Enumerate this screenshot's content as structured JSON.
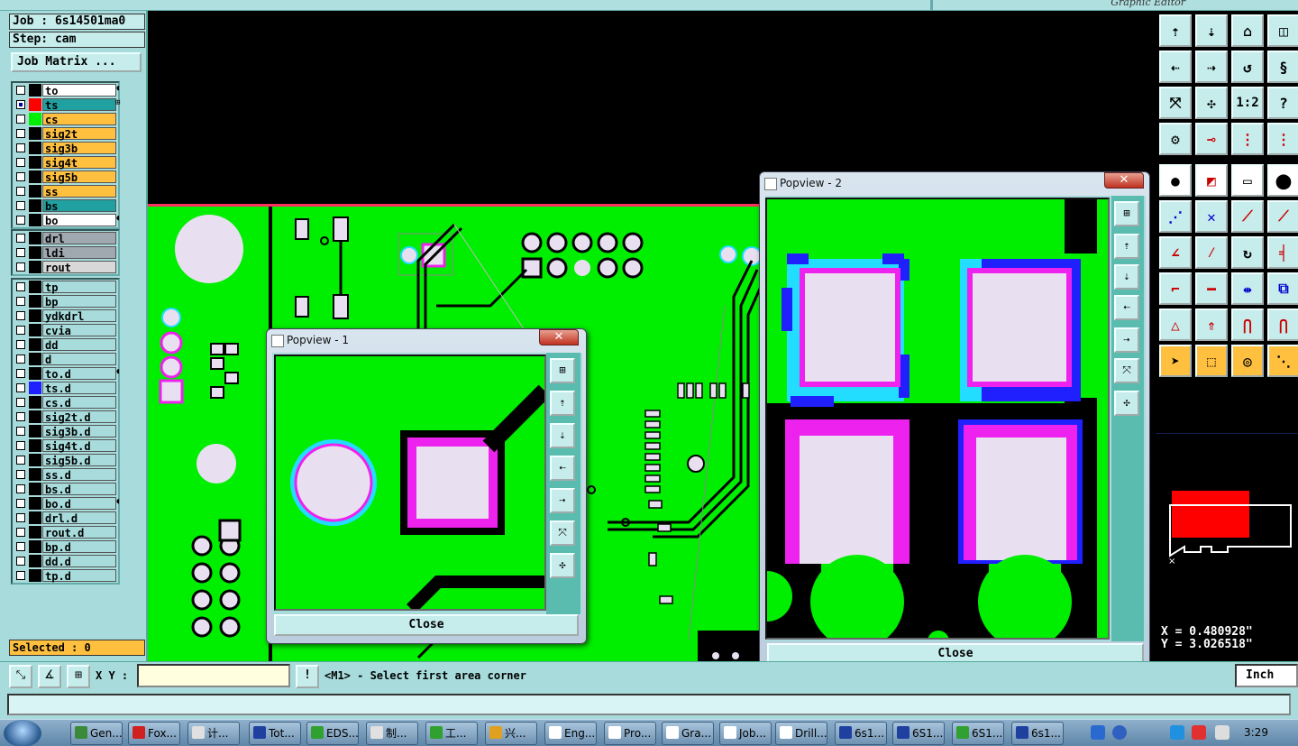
{
  "window": {
    "title_fragment": "Graphic Editor"
  },
  "left": {
    "job_label": "Job : 6s14501ma0",
    "step_label": "Step: cam",
    "job_matrix": "Job Matrix ...",
    "selected": "Selected : 0",
    "group1": [
      {
        "name": "to",
        "sel": "white",
        "mark": "◖",
        "color": "#000000",
        "checked": false
      },
      {
        "name": "ts",
        "sel": "teal",
        "mark": "⊞",
        "color": "#ff0000",
        "checked": true
      },
      {
        "name": "cs",
        "sel": "orange",
        "mark": "",
        "color": "#00ee00",
        "checked": false
      },
      {
        "name": "sig2t",
        "sel": "orange",
        "mark": "",
        "color": "#000000",
        "checked": false
      },
      {
        "name": "sig3b",
        "sel": "orange",
        "mark": "",
        "color": "#000000",
        "checked": false
      },
      {
        "name": "sig4t",
        "sel": "orange",
        "mark": "",
        "color": "#000000",
        "checked": false
      },
      {
        "name": "sig5b",
        "sel": "orange",
        "mark": "",
        "color": "#000000",
        "checked": false
      },
      {
        "name": "ss",
        "sel": "orange",
        "mark": "",
        "color": "#000000",
        "checked": false
      },
      {
        "name": "bs",
        "sel": "teal",
        "mark": "",
        "color": "#000000",
        "checked": false
      },
      {
        "name": "bo",
        "sel": "white",
        "mark": "◖",
        "color": "#000000",
        "checked": false
      }
    ],
    "group2": [
      {
        "name": "drl",
        "sel": "gray",
        "mark": "",
        "color": "#000000",
        "checked": false
      },
      {
        "name": "ldi",
        "sel": "gray",
        "mark": "",
        "color": "#000000",
        "checked": false
      },
      {
        "name": "rout",
        "sel": "lgray",
        "mark": "",
        "color": "#000000",
        "checked": false
      }
    ],
    "group3": [
      {
        "name": "tp",
        "sel": "light",
        "mark": "",
        "color": "#000000",
        "checked": false
      },
      {
        "name": "bp",
        "sel": "light",
        "mark": "",
        "color": "#000000",
        "checked": false
      },
      {
        "name": "ydkdrl",
        "sel": "light",
        "mark": "",
        "color": "#000000",
        "checked": false
      },
      {
        "name": "cvia",
        "sel": "light",
        "mark": "",
        "color": "#000000",
        "checked": false
      },
      {
        "name": "dd",
        "sel": "light",
        "mark": "",
        "color": "#000000",
        "checked": false
      },
      {
        "name": "d",
        "sel": "light",
        "mark": "",
        "color": "#000000",
        "checked": false
      },
      {
        "name": "to.d",
        "sel": "light",
        "mark": "◖",
        "color": "#000000",
        "checked": false
      },
      {
        "name": "ts.d",
        "sel": "light",
        "mark": "",
        "color": "#2020ff",
        "checked": false
      },
      {
        "name": "cs.d",
        "sel": "light",
        "mark": "",
        "color": "#000000",
        "checked": false
      },
      {
        "name": "sig2t.d",
        "sel": "light",
        "mark": "",
        "color": "#000000",
        "checked": false
      },
      {
        "name": "sig3b.d",
        "sel": "light",
        "mark": "",
        "color": "#000000",
        "checked": false
      },
      {
        "name": "sig4t.d",
        "sel": "light",
        "mark": "",
        "color": "#000000",
        "checked": false
      },
      {
        "name": "sig5b.d",
        "sel": "light",
        "mark": "",
        "color": "#000000",
        "checked": false
      },
      {
        "name": "ss.d",
        "sel": "light",
        "mark": "",
        "color": "#000000",
        "checked": false
      },
      {
        "name": "bs.d",
        "sel": "light",
        "mark": "",
        "color": "#000000",
        "checked": false
      },
      {
        "name": "bo.d",
        "sel": "light",
        "mark": "◖",
        "color": "#000000",
        "checked": false
      },
      {
        "name": "drl.d",
        "sel": "light",
        "mark": "",
        "color": "#000000",
        "checked": false
      },
      {
        "name": "rout.d",
        "sel": "light",
        "mark": "",
        "color": "#000000",
        "checked": false
      },
      {
        "name": "bp.d",
        "sel": "light",
        "mark": "",
        "color": "#000000",
        "checked": false
      },
      {
        "name": "dd.d",
        "sel": "light",
        "mark": "",
        "color": "#000000",
        "checked": false
      },
      {
        "name": "tp.d",
        "sel": "light",
        "mark": "",
        "color": "#000000",
        "checked": false
      }
    ]
  },
  "popup1": {
    "title": "Popview - 1",
    "close_x": "✕",
    "close_label": "Close"
  },
  "popup2": {
    "title": "Popview - 2",
    "close_x": "✕",
    "close_label": "Close"
  },
  "coords": {
    "x": "X = 0.480928\"",
    "y": "Y = 3.026518\""
  },
  "status": {
    "xy_label": "X Y :",
    "xy_value": "",
    "prompt": "<M1> - Select first area corner",
    "units": "Inch"
  },
  "colors": {
    "board": "#00ee00",
    "pad": "#e8e0f0",
    "magenta": "#ee22ee",
    "cyan": "#22ddff",
    "blue": "#2020ff",
    "panel": "#a8dcdc",
    "accent": "#ffc040"
  },
  "taskbar": {
    "items": [
      {
        "label": "Gen...",
        "icon": "#3a8a3a"
      },
      {
        "label": "Fox...",
        "icon": "#d02020"
      },
      {
        "label": "计...",
        "icon": "#e0e0e0"
      },
      {
        "label": "Tot...",
        "icon": "#2040a0"
      },
      {
        "label": "EDS...",
        "icon": "#30a030"
      },
      {
        "label": "制...",
        "icon": "#e0e0e0"
      },
      {
        "label": "工...",
        "icon": "#30a030"
      },
      {
        "label": "兴...",
        "icon": "#e0a020"
      },
      {
        "label": "Eng...",
        "icon": "#ffffff"
      },
      {
        "label": "Pro...",
        "icon": "#ffffff"
      },
      {
        "label": "Gra...",
        "icon": "#ffffff"
      },
      {
        "label": "Job...",
        "icon": "#ffffff"
      },
      {
        "label": "Drill...",
        "icon": "#ffffff"
      },
      {
        "label": "6s1...",
        "icon": "#2040a0"
      },
      {
        "label": "6S1...",
        "icon": "#2040a0"
      },
      {
        "label": "6S1...",
        "icon": "#30a030"
      },
      {
        "label": "6s1...",
        "icon": "#2040a0"
      }
    ],
    "clock": "3:29"
  }
}
